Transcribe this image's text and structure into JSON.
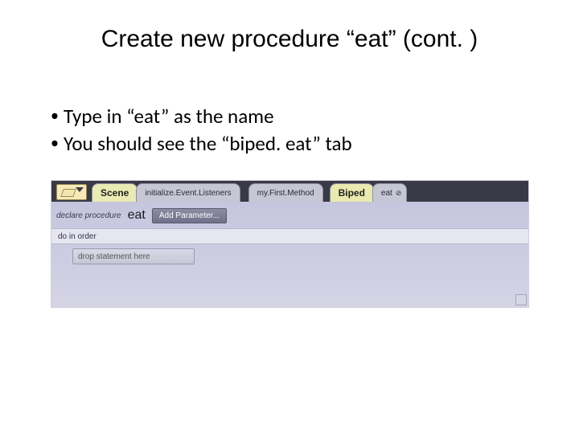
{
  "title": "Create new procedure “eat” (cont. )",
  "bullets": [
    "Type in “eat” as the name",
    "You should see the “biped. eat” tab"
  ],
  "ide": {
    "tabs": {
      "scene": "Scene",
      "init": "initialize.Event.Listeners",
      "myfirst": "my.First.Method",
      "biped": "Biped",
      "eat": "eat",
      "eat_close": "⊘"
    },
    "declare_label": "declare procedure",
    "procedure_name": "eat",
    "add_param_btn": "Add Parameter...",
    "do_in_order": "do in order",
    "drop_hint": "drop statement here"
  }
}
